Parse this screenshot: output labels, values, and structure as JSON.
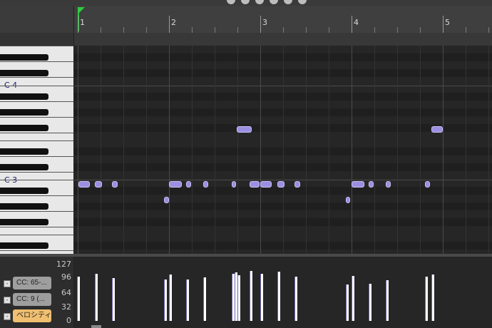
{
  "ruler": {
    "bars": [
      "1",
      "2",
      "3",
      "4",
      "5"
    ]
  },
  "keyboard": {
    "labels": {
      "c4": "C 4",
      "c3": "C 3"
    }
  },
  "control_lane": {
    "scale": [
      "127",
      "96",
      "64",
      "32",
      "0"
    ],
    "buttons": [
      {
        "label": "CC: 65-...",
        "active": false
      },
      {
        "label": "CC: 9 (...",
        "active": false
      },
      {
        "label": "ベロシティ",
        "active": true
      }
    ]
  },
  "colors": {
    "note": "#9a8fe0",
    "playhead": "#2ecc40",
    "active_button": "#f0c070"
  }
}
